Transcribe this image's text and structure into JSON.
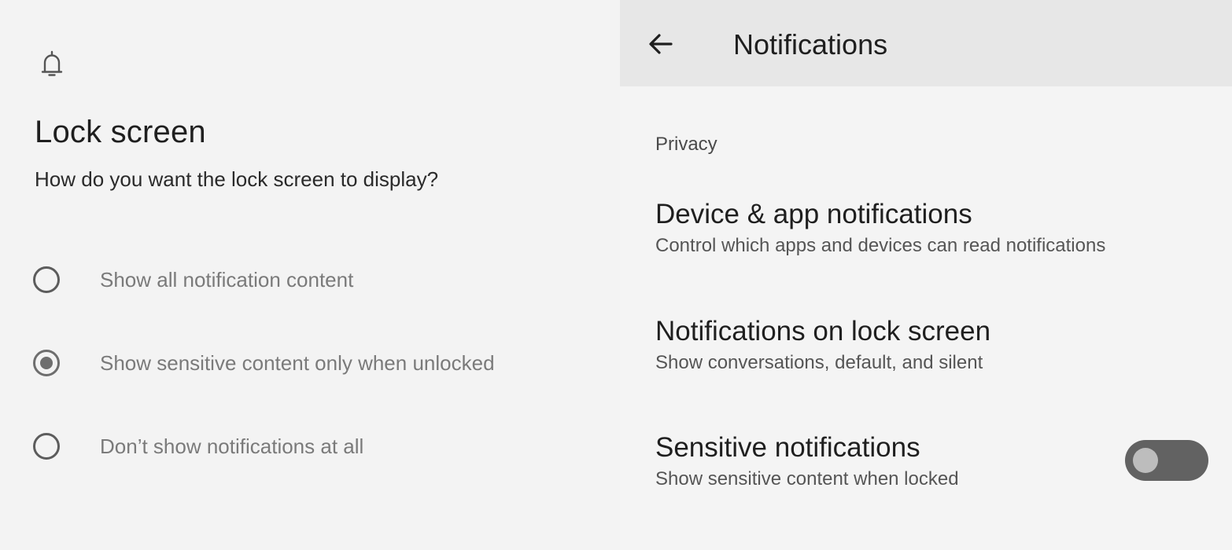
{
  "lock_screen_dialog": {
    "icon": "bell-icon",
    "title": "Lock screen",
    "question": "How do you want the lock screen to display?",
    "options": [
      {
        "label": "Show all notification content",
        "selected": false
      },
      {
        "label": "Show sensitive content only when unlocked",
        "selected": true
      },
      {
        "label": "Don’t show notifications at all",
        "selected": false
      }
    ]
  },
  "notifications_screen": {
    "app_bar": {
      "back_icon": "arrow-back-icon",
      "title": "Notifications"
    },
    "section_header": "Privacy",
    "items": [
      {
        "title": "Device & app notifications",
        "summary": "Control which apps and devices can read notifications"
      },
      {
        "title": "Notifications on lock screen",
        "summary": "Show conversations, default, and silent"
      },
      {
        "title": "Sensitive notifications",
        "summary": "Show sensitive content when locked",
        "toggle_on": false
      }
    ]
  },
  "colors": {
    "background": "#f4f4f4",
    "app_bar": "#e7e7e7",
    "toggle_track_off": "#626262",
    "toggle_thumb_off": "#bdbdbd",
    "radio": "#6e6e6e"
  }
}
